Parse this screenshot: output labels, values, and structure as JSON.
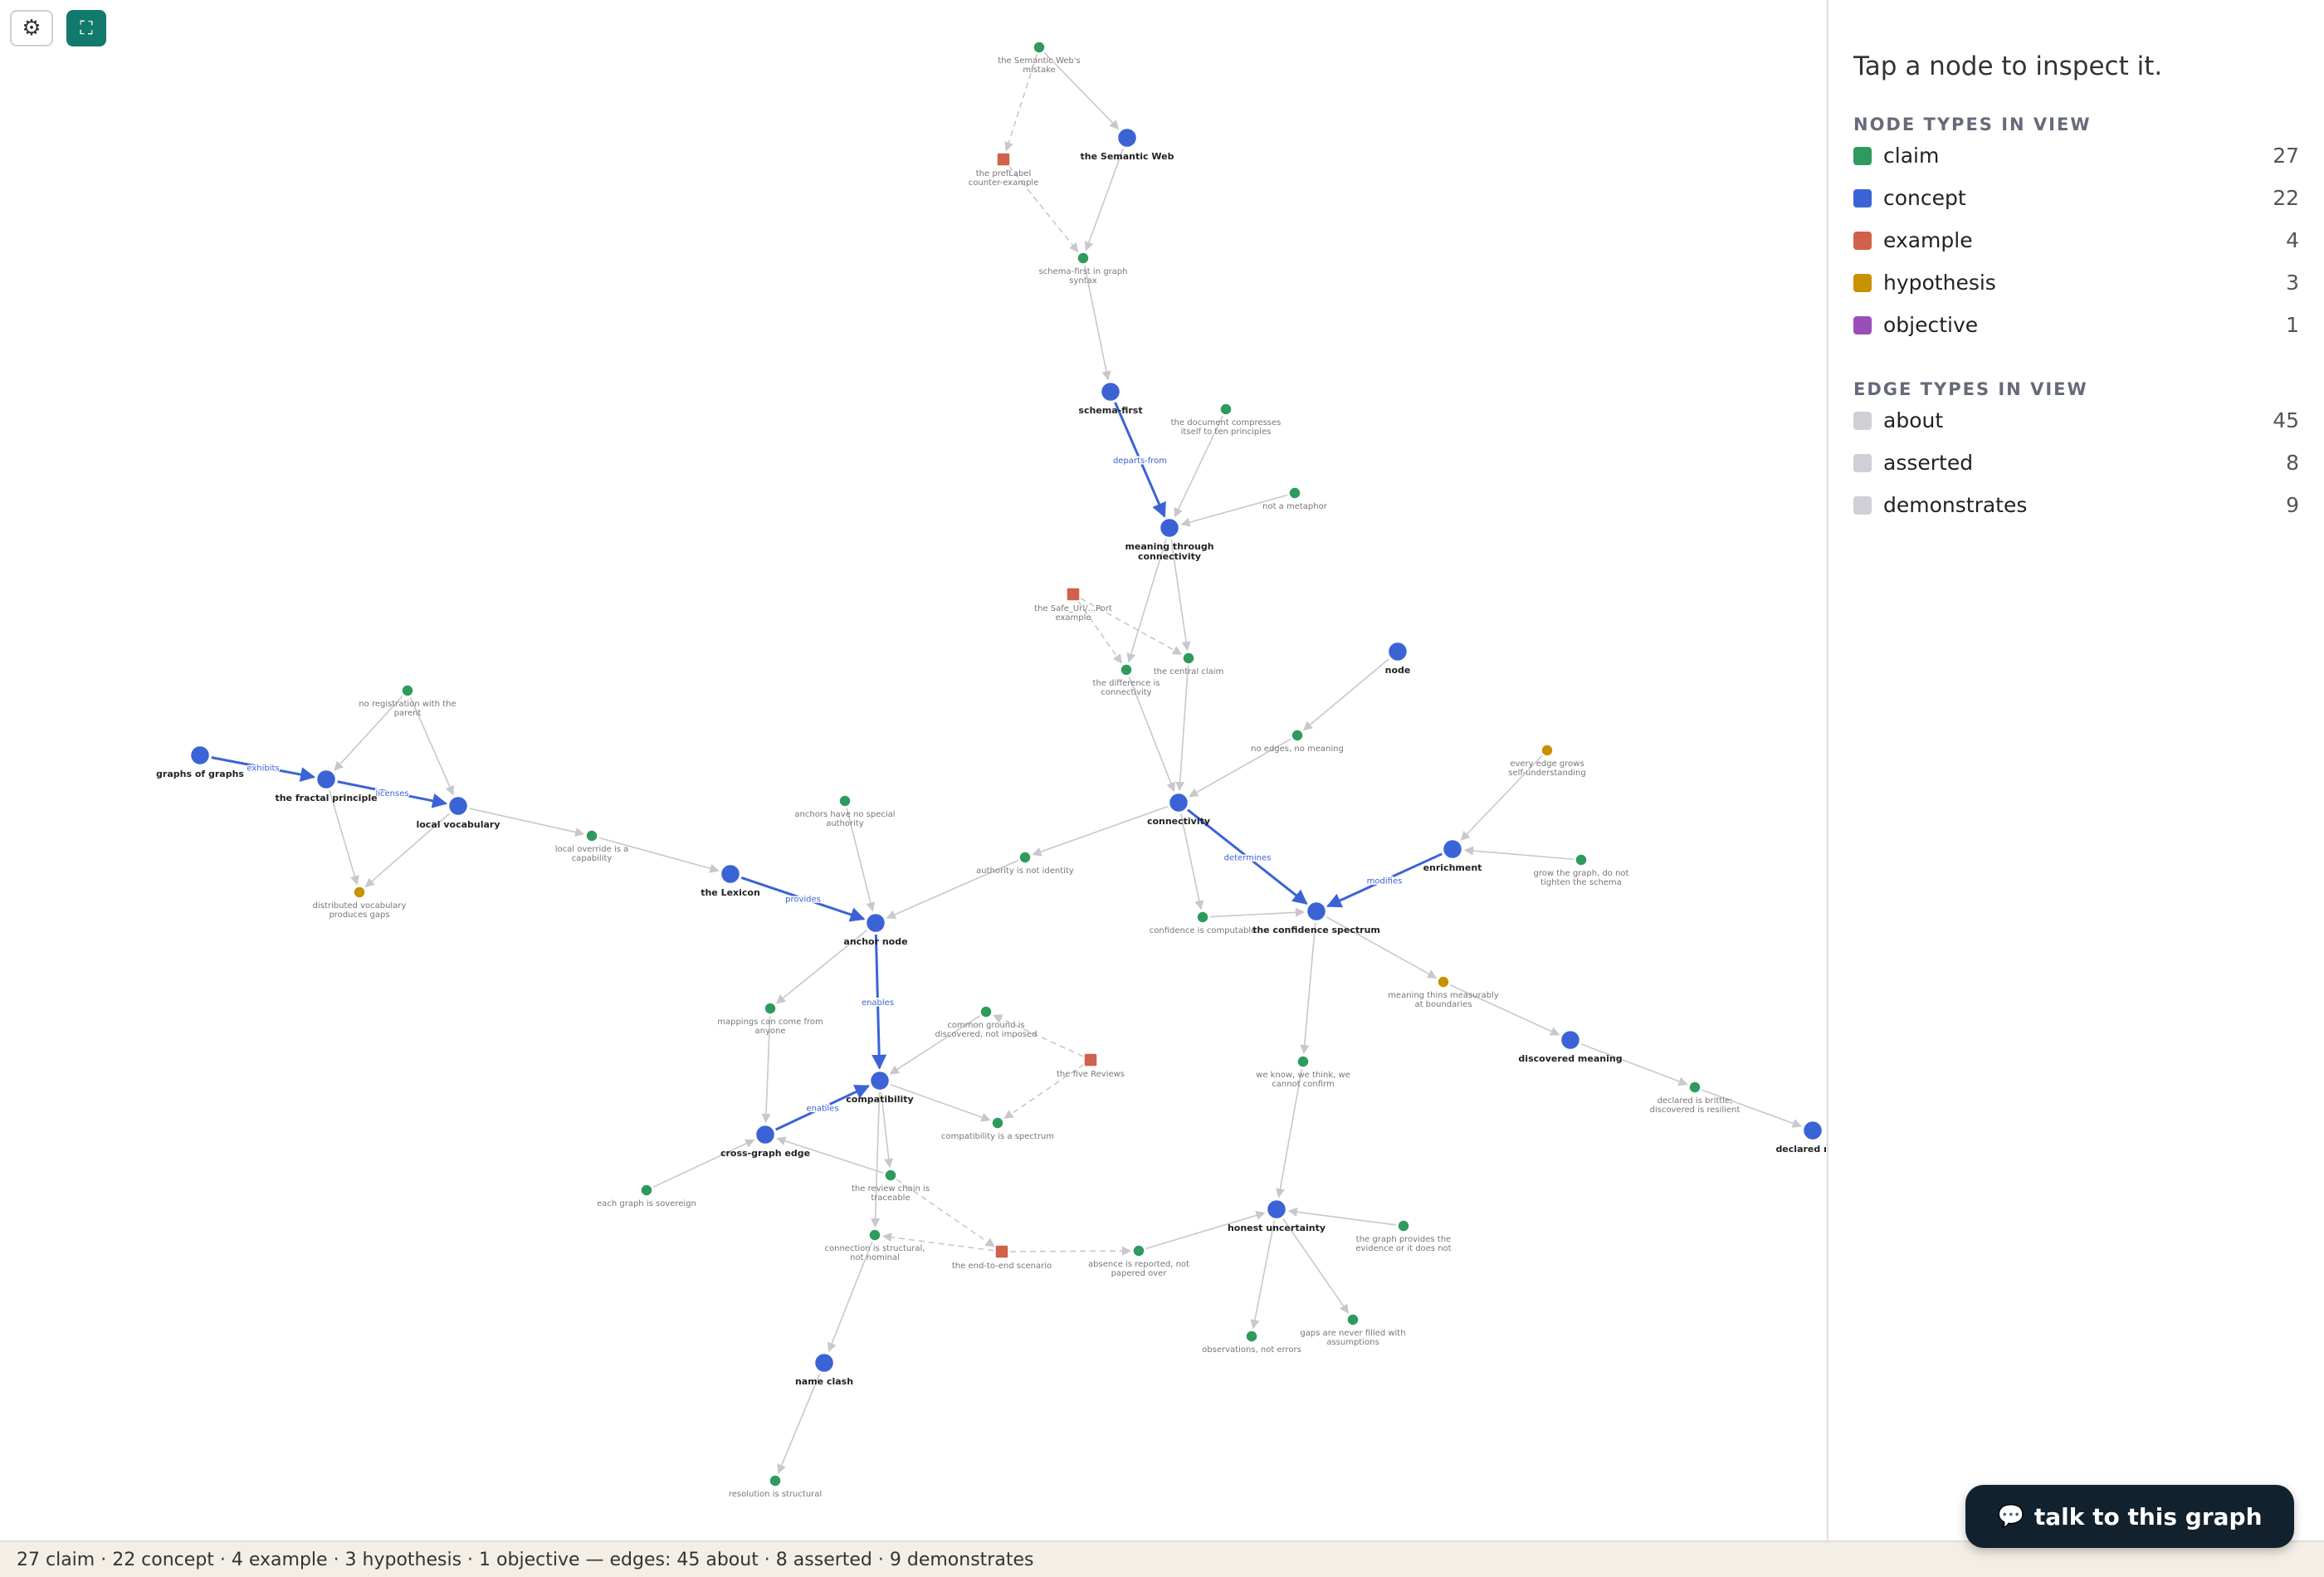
{
  "toolbar": {
    "settings_icon": "gear-icon",
    "settings_glyph": "⚙",
    "expand_icon": "expand-icon",
    "expand_glyph": "⛶"
  },
  "sidebar": {
    "prompt": "Tap a node to inspect it.",
    "node_types_heading": "NODE TYPES IN VIEW",
    "node_types": [
      {
        "name": "claim",
        "count": "27",
        "color": "#2e9a5e"
      },
      {
        "name": "concept",
        "count": "22",
        "color": "#3b63d6"
      },
      {
        "name": "example",
        "count": "4",
        "color": "#d0614a"
      },
      {
        "name": "hypothesis",
        "count": "3",
        "color": "#c99000"
      },
      {
        "name": "objective",
        "count": "1",
        "color": "#9a4fb8"
      }
    ],
    "edge_types_heading": "EDGE TYPES IN VIEW",
    "edge_types": [
      {
        "name": "about",
        "count": "45",
        "color": "#cfcfd6"
      },
      {
        "name": "asserted",
        "count": "8",
        "color": "#cfcfd6"
      },
      {
        "name": "demonstrates",
        "count": "9",
        "color": "#cfcfd6"
      }
    ]
  },
  "footer": {
    "summary": "27 claim · 22 concept · 4 example · 3 hypothesis · 1 objective — edges: 45 about · 8 asserted · 9 demonstrates"
  },
  "chat_button": {
    "label": "talk to this graph",
    "icon": "chat-bubble-icon",
    "glyph": "💬"
  },
  "colors": {
    "claim": "#2e9a5e",
    "concept": "#3b63d6",
    "example": "#d0614a",
    "hypothesis": "#c99000",
    "edge": "#c8c8cc",
    "edge_strong": "#3b63d6"
  },
  "graph": {
    "nodes": [
      {
        "id": "sw_mistake",
        "type": "claim",
        "lines": [
          "the Semantic Web's",
          "mistake"
        ]
      },
      {
        "id": "sw",
        "type": "concept",
        "lines": [
          "the Semantic Web"
        ]
      },
      {
        "id": "preflabel",
        "type": "example",
        "lines": [
          "the prefLabel",
          "counter-example"
        ]
      },
      {
        "id": "schema_graph",
        "type": "claim",
        "lines": [
          "schema-first in graph",
          "syntax"
        ]
      },
      {
        "id": "schema_first",
        "type": "concept",
        "lines": [
          "schema-first"
        ]
      },
      {
        "id": "compresses",
        "type": "claim",
        "lines": [
          "the document compresses",
          "itself to ten principles"
        ]
      },
      {
        "id": "metaphor",
        "type": "claim",
        "lines": [
          "not a metaphor"
        ]
      },
      {
        "id": "mtc",
        "type": "concept",
        "lines": [
          "meaning through",
          "connectivity"
        ]
      },
      {
        "id": "safe_url",
        "type": "example",
        "lines": [
          "the Safe_Url/...Port",
          "example"
        ]
      },
      {
        "id": "diff_conn",
        "type": "claim",
        "lines": [
          "the difference is",
          "connectivity"
        ]
      },
      {
        "id": "central",
        "type": "claim",
        "lines": [
          "the central claim"
        ]
      },
      {
        "id": "node",
        "type": "concept",
        "lines": [
          "node"
        ]
      },
      {
        "id": "no_edges",
        "type": "claim",
        "lines": [
          "no edges, no meaning"
        ]
      },
      {
        "id": "every_edge",
        "type": "hypothesis",
        "lines": [
          "every edge grows",
          "self-understanding"
        ]
      },
      {
        "id": "connectivity",
        "type": "concept",
        "lines": [
          "connectivity"
        ]
      },
      {
        "id": "enrichment",
        "type": "concept",
        "lines": [
          "enrichment"
        ]
      },
      {
        "id": "grow_graph",
        "type": "claim",
        "lines": [
          "grow the graph, do not",
          "tighten the schema"
        ]
      },
      {
        "id": "conf_comp",
        "type": "claim",
        "lines": [
          "confidence is computable"
        ]
      },
      {
        "id": "conf_spec",
        "type": "concept",
        "lines": [
          "the confidence spectrum"
        ]
      },
      {
        "id": "meaning_thins",
        "type": "hypothesis",
        "lines": [
          "meaning thins measurably",
          "at boundaries"
        ]
      },
      {
        "id": "discovered",
        "type": "concept",
        "lines": [
          "discovered meaning"
        ]
      },
      {
        "id": "brittle",
        "type": "claim",
        "lines": [
          "declared is brittle;",
          "discovered is resilient"
        ]
      },
      {
        "id": "declared",
        "type": "concept",
        "lines": [
          "declared me..."
        ]
      },
      {
        "id": "no_reg",
        "type": "claim",
        "lines": [
          "no registration with the",
          "parent"
        ]
      },
      {
        "id": "gog",
        "type": "concept",
        "lines": [
          "graphs of graphs"
        ]
      },
      {
        "id": "fractal",
        "type": "concept",
        "lines": [
          "the fractal principle"
        ]
      },
      {
        "id": "local_vocab",
        "type": "concept",
        "lines": [
          "local vocabulary"
        ]
      },
      {
        "id": "dist_vocab",
        "type": "hypothesis",
        "lines": [
          "distributed vocabulary",
          "produces gaps"
        ]
      },
      {
        "id": "local_override",
        "type": "claim",
        "lines": [
          "local override is a",
          "capability"
        ]
      },
      {
        "id": "lexicon",
        "type": "concept",
        "lines": [
          "the Lexicon"
        ]
      },
      {
        "id": "anchors",
        "type": "claim",
        "lines": [
          "anchors have no special",
          "authority"
        ]
      },
      {
        "id": "authority",
        "type": "claim",
        "lines": [
          "authority is not identity"
        ]
      },
      {
        "id": "anchor_node",
        "type": "concept",
        "lines": [
          "anchor node"
        ]
      },
      {
        "id": "mappings",
        "type": "claim",
        "lines": [
          "mappings can come from",
          "anyone"
        ]
      },
      {
        "id": "common_ground",
        "type": "claim",
        "lines": [
          "common ground is",
          "discovered, not imposed"
        ]
      },
      {
        "id": "five_reviews",
        "type": "example",
        "lines": [
          "the five Reviews"
        ]
      },
      {
        "id": "compat",
        "type": "concept",
        "lines": [
          "compatibility"
        ]
      },
      {
        "id": "compat_spec",
        "type": "claim",
        "lines": [
          "compatibility is a spectrum"
        ]
      },
      {
        "id": "cge",
        "type": "concept",
        "lines": [
          "cross-graph edge"
        ]
      },
      {
        "id": "sovereign",
        "type": "claim",
        "lines": [
          "each graph is sovereign"
        ]
      },
      {
        "id": "review_chain",
        "type": "claim",
        "lines": [
          "the review chain is",
          "traceable"
        ]
      },
      {
        "id": "structural",
        "type": "claim",
        "lines": [
          "connection is structural,",
          "not nominal"
        ]
      },
      {
        "id": "e2e",
        "type": "example",
        "lines": [
          "the end-to-end scenario"
        ]
      },
      {
        "id": "absence",
        "type": "claim",
        "lines": [
          "absence is reported, not",
          "papered over"
        ]
      },
      {
        "id": "we_know",
        "type": "claim",
        "lines": [
          "we know, we think, we",
          "cannot confirm"
        ]
      },
      {
        "id": "honest",
        "type": "concept",
        "lines": [
          "honest uncertainty"
        ]
      },
      {
        "id": "provides_ev",
        "type": "claim",
        "lines": [
          "the graph provides the",
          "evidence or it does not"
        ]
      },
      {
        "id": "observations",
        "type": "claim",
        "lines": [
          "observations, not errors"
        ]
      },
      {
        "id": "gaps",
        "type": "claim",
        "lines": [
          "gaps are never filled with",
          "assumptions"
        ]
      },
      {
        "id": "name_clash",
        "type": "concept",
        "lines": [
          "name clash"
        ]
      },
      {
        "id": "resolution",
        "type": "claim",
        "lines": [
          "resolution is structural"
        ]
      }
    ],
    "edges": [
      {
        "from": "sw_mistake",
        "to": "sw",
        "kind": "about"
      },
      {
        "from": "sw_mistake",
        "to": "preflabel",
        "kind": "demonstrates"
      },
      {
        "from": "preflabel",
        "to": "schema_graph",
        "kind": "demonstrates"
      },
      {
        "from": "sw",
        "to": "schema_graph",
        "kind": "about"
      },
      {
        "from": "schema_graph",
        "to": "schema_first",
        "kind": "about"
      },
      {
        "from": "schema_first",
        "to": "mtc",
        "kind": "strong",
        "label": "departs-from"
      },
      {
        "from": "compresses",
        "to": "mtc",
        "kind": "about"
      },
      {
        "from": "metaphor",
        "to": "mtc",
        "kind": "about"
      },
      {
        "from": "mtc",
        "to": "diff_conn",
        "kind": "about"
      },
      {
        "from": "mtc",
        "to": "central",
        "kind": "about"
      },
      {
        "from": "safe_url",
        "to": "diff_conn",
        "kind": "demonstrates"
      },
      {
        "from": "safe_url",
        "to": "central",
        "kind": "demonstrates"
      },
      {
        "from": "diff_conn",
        "to": "connectivity",
        "kind": "about"
      },
      {
        "from": "central",
        "to": "connectivity",
        "kind": "about"
      },
      {
        "from": "node",
        "to": "no_edges",
        "kind": "about"
      },
      {
        "from": "no_edges",
        "to": "connectivity",
        "kind": "about"
      },
      {
        "from": "connectivity",
        "to": "conf_spec",
        "kind": "strong",
        "label": "determines"
      },
      {
        "from": "connectivity",
        "to": "conf_comp",
        "kind": "about"
      },
      {
        "from": "conf_comp",
        "to": "conf_spec",
        "kind": "about"
      },
      {
        "from": "enrichment",
        "to": "conf_spec",
        "kind": "strong",
        "label": "modifies"
      },
      {
        "from": "every_edge",
        "to": "enrichment",
        "kind": "about"
      },
      {
        "from": "grow_graph",
        "to": "enrichment",
        "kind": "about"
      },
      {
        "from": "conf_spec",
        "to": "meaning_thins",
        "kind": "about"
      },
      {
        "from": "meaning_thins",
        "to": "discovered",
        "kind": "about"
      },
      {
        "from": "discovered",
        "to": "brittle",
        "kind": "about"
      },
      {
        "from": "brittle",
        "to": "declared",
        "kind": "about"
      },
      {
        "from": "conf_spec",
        "to": "we_know",
        "kind": "about"
      },
      {
        "from": "we_know",
        "to": "honest",
        "kind": "about"
      },
      {
        "from": "provides_ev",
        "to": "honest",
        "kind": "about"
      },
      {
        "from": "honest",
        "to": "observations",
        "kind": "about"
      },
      {
        "from": "honest",
        "to": "gaps",
        "kind": "about"
      },
      {
        "from": "absence",
        "to": "honest",
        "kind": "about"
      },
      {
        "from": "e2e",
        "to": "absence",
        "kind": "demonstrates"
      },
      {
        "from": "gog",
        "to": "fractal",
        "kind": "strong",
        "label": "exhibits"
      },
      {
        "from": "fractal",
        "to": "local_vocab",
        "kind": "strong",
        "label": "licenses"
      },
      {
        "from": "no_reg",
        "to": "fractal",
        "kind": "about"
      },
      {
        "from": "no_reg",
        "to": "local_vocab",
        "kind": "about"
      },
      {
        "from": "fractal",
        "to": "dist_vocab",
        "kind": "about"
      },
      {
        "from": "local_vocab",
        "to": "dist_vocab",
        "kind": "about"
      },
      {
        "from": "local_vocab",
        "to": "local_override",
        "kind": "about"
      },
      {
        "from": "local_override",
        "to": "lexicon",
        "kind": "about"
      },
      {
        "from": "lexicon",
        "to": "anchor_node",
        "kind": "strong",
        "label": "provides"
      },
      {
        "from": "anchors",
        "to": "anchor_node",
        "kind": "about"
      },
      {
        "from": "connectivity",
        "to": "authority",
        "kind": "about"
      },
      {
        "from": "authority",
        "to": "anchor_node",
        "kind": "about"
      },
      {
        "from": "anchor_node",
        "to": "compat",
        "kind": "strong",
        "label": "enables"
      },
      {
        "from": "anchor_node",
        "to": "mappings",
        "kind": "about"
      },
      {
        "from": "mappings",
        "to": "cge",
        "kind": "about"
      },
      {
        "from": "cge",
        "to": "compat",
        "kind": "strong",
        "label": "enables"
      },
      {
        "from": "common_ground",
        "to": "compat",
        "kind": "about"
      },
      {
        "from": "five_reviews",
        "to": "common_ground",
        "kind": "demonstrates"
      },
      {
        "from": "five_reviews",
        "to": "compat_spec",
        "kind": "demonstrates"
      },
      {
        "from": "compat",
        "to": "compat_spec",
        "kind": "about"
      },
      {
        "from": "compat",
        "to": "review_chain",
        "kind": "about"
      },
      {
        "from": "compat",
        "to": "structural",
        "kind": "about"
      },
      {
        "from": "review_chain",
        "to": "cge",
        "kind": "about"
      },
      {
        "from": "sovereign",
        "to": "cge",
        "kind": "about"
      },
      {
        "from": "review_chain",
        "to": "e2e",
        "kind": "demonstrates"
      },
      {
        "from": "e2e",
        "to": "structural",
        "kind": "demonstrates"
      },
      {
        "from": "structural",
        "to": "name_clash",
        "kind": "about"
      },
      {
        "from": "name_clash",
        "to": "resolution",
        "kind": "about"
      }
    ]
  }
}
